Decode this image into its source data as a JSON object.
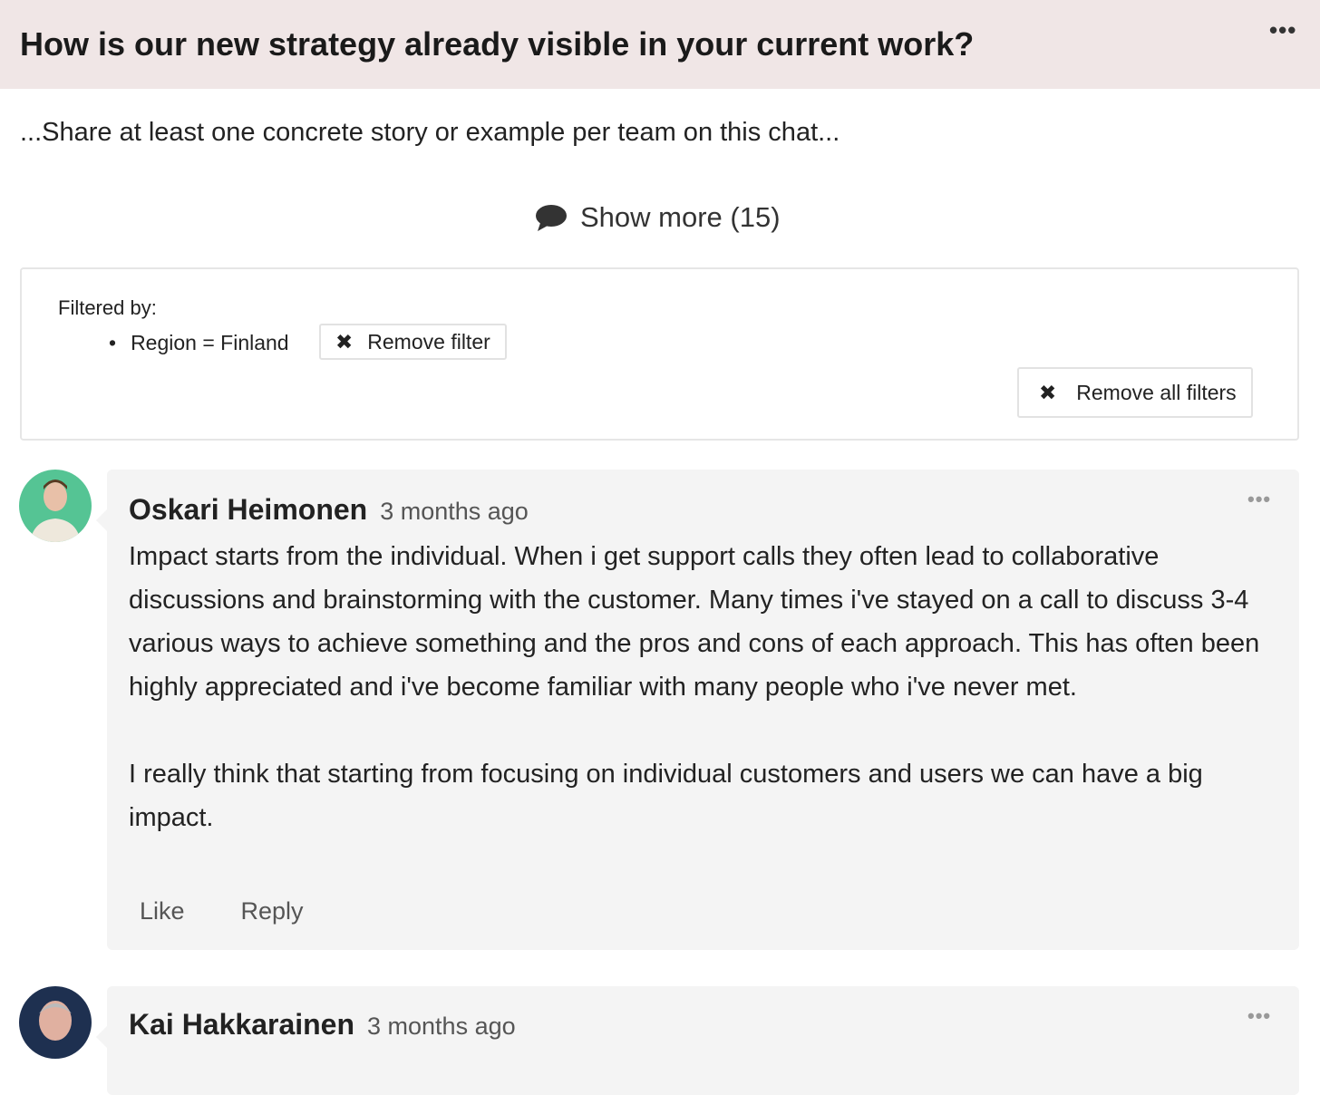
{
  "header": {
    "title": "How is our new strategy already visible in your current work?",
    "menu_icon": "more-horizontal-icon"
  },
  "description": "...Share at least one concrete story or example per team on this chat...",
  "show_more": {
    "label": "Show more (15)",
    "icon": "speech-bubble-icon"
  },
  "filters": {
    "label": "Filtered by:",
    "items": [
      {
        "text": "Region = Finland",
        "remove_label": "Remove filter"
      }
    ],
    "remove_all_label": "Remove all filters"
  },
  "comments": [
    {
      "author": "Oskari Heimonen",
      "time": "3 months ago",
      "avatar_color": "#55c494",
      "paragraphs": [
        "Impact starts from the individual. When i get support calls they often lead to collaborative discussions and brainstorming with the customer. Many times i've stayed on a call to discuss 3-4 various ways to achieve something and the pros and cons of each approach. This has often been highly appreciated and i've become familiar with many people who i've never met.",
        "I really think that starting from focusing on individual customers and users we can have a big impact."
      ],
      "like_label": "Like",
      "reply_label": "Reply"
    },
    {
      "author": "Kai Hakkarainen",
      "time": "3 months ago",
      "avatar_color": "#1e3050"
    }
  ]
}
